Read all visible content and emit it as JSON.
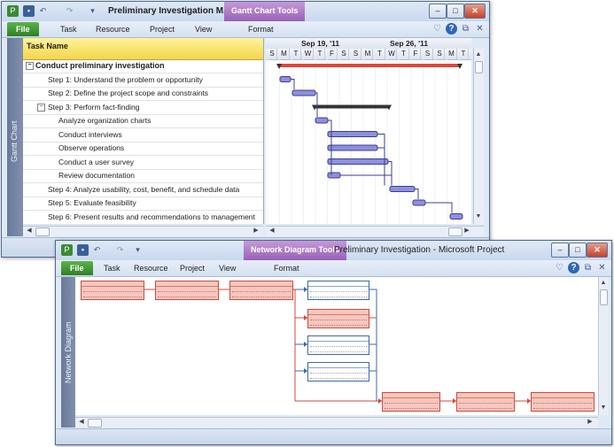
{
  "gantt_window": {
    "title": "Preliminary Investigation M...",
    "context_tab": "Gantt Chart Tools",
    "ribbon_tabs": [
      "File",
      "Task",
      "Resource",
      "Project",
      "View",
      "Format"
    ],
    "view_label": "Gantt Chart",
    "column_header": "Task Name",
    "weeks": [
      "Sep 19, '11",
      "Sep 26, '11"
    ],
    "days": [
      "S",
      "M",
      "T",
      "W",
      "T",
      "F",
      "S",
      "S",
      "M",
      "T",
      "W",
      "T",
      "F",
      "S",
      "S",
      "M",
      "T"
    ],
    "tasks": [
      {
        "name": "Conduct preliminary investigation",
        "level": 0,
        "summary": true,
        "collapsed": false
      },
      {
        "name": "Step 1: Understand the problem or opportunity",
        "level": 1
      },
      {
        "name": "Step 2: Define the project scope and constraints",
        "level": 1
      },
      {
        "name": "Step 3: Perform fact-finding",
        "level": 1,
        "summary": true,
        "collapsed": false
      },
      {
        "name": "Analyze organization charts",
        "level": 2
      },
      {
        "name": "Conduct interviews",
        "level": 2
      },
      {
        "name": "Observe operations",
        "level": 2
      },
      {
        "name": "Conduct a user survey",
        "level": 2
      },
      {
        "name": "Review documentation",
        "level": 2
      },
      {
        "name": "Step 4: Analyze usability, cost, benefit, and schedule data",
        "level": 1
      },
      {
        "name": "Step 5: Evaluate feasibility",
        "level": 1
      },
      {
        "name": "Step 6: Present results and recommendations to management",
        "level": 1
      }
    ],
    "expander_minus": "−"
  },
  "network_window": {
    "context_tab": "Network Diagram Tools",
    "title": "Preliminary Investigation  -  Microsoft Project",
    "ribbon_tabs": [
      "File",
      "Task",
      "Resource",
      "Project",
      "View",
      "Format"
    ],
    "view_label": "Network Diagram"
  },
  "icons": {
    "app": "project-icon",
    "save": "save-icon",
    "undo": "undo-icon",
    "redo": "redo-icon",
    "customize": "customize-qat-icon",
    "minimize": "minimize-icon",
    "maximize": "maximize-icon",
    "close": "close-icon",
    "ribbon_collapse": "ribbon-collapse-icon",
    "help": "help-icon",
    "restore": "restore-icon"
  },
  "glyphs": {
    "app": "P",
    "save": "▪",
    "undo": "↶",
    "redo": "↷",
    "customize": "▾",
    "minimize": "–",
    "maximize": "□",
    "close": "✕",
    "ribbon_collapse": "♡",
    "help": "?",
    "restore": "⧉",
    "left": "◀",
    "right": "▶",
    "up": "▲",
    "down": "▼",
    "grip": "|||"
  },
  "colors": {
    "critical": "#d04a3b",
    "normal": "#3d67a8",
    "file_tab": "#2f7f26",
    "context_tab": "#9861b6",
    "gantt_bar": "#6a6fd0"
  }
}
